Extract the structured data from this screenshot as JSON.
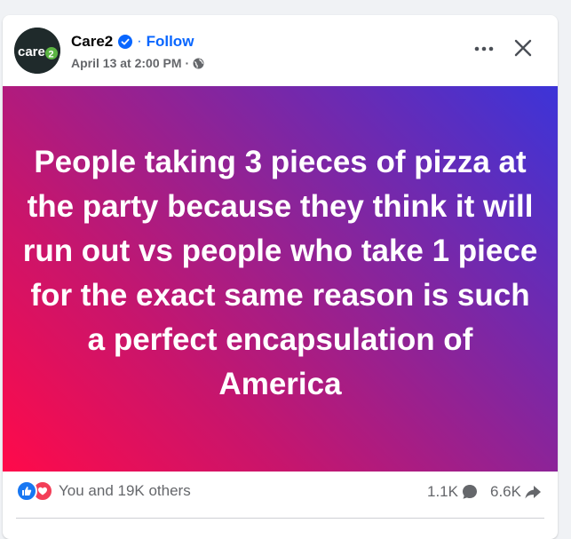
{
  "post": {
    "author": "Care2",
    "follow_label": "Follow",
    "separator": "·",
    "timestamp": "April 13 at 2:00 PM",
    "audience_icon": "globe-icon",
    "avatar_text": "care2",
    "text": "People taking 3 pieces of pizza at the party because they think it will run out vs people who take 1 piece for the exact same reason is such a perfect encapsulation of America"
  },
  "stats": {
    "reactions_text": "You and 19K others",
    "comments": "1.1K",
    "shares": "6.6K"
  },
  "colors": {
    "accent": "#0866ff",
    "gradient_start": "#ff0a4a",
    "gradient_end": "#3c34d8",
    "like": "#1877f2",
    "love": "#f33e58",
    "avatar_green": "#5bb543"
  }
}
